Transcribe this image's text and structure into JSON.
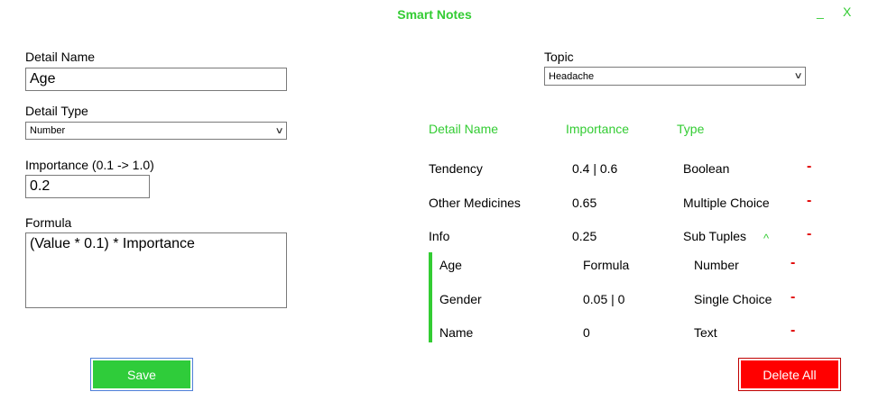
{
  "window": {
    "title": "Smart Notes",
    "minimize": "_",
    "close": "X"
  },
  "form": {
    "detail_name_label": "Detail Name",
    "detail_name_value": "Age",
    "detail_type_label": "Detail Type",
    "detail_type_value": "Number",
    "importance_label": "Importance (0.1 -> 1.0)",
    "importance_value": "0.2",
    "formula_label": "Formula",
    "formula_value": "(Value * 0.1) * Importance",
    "topic_label": "Topic",
    "topic_value": "Headache"
  },
  "table": {
    "headers": {
      "name": "Detail Name",
      "importance": "Importance",
      "type": "Type"
    },
    "rows": [
      {
        "name": "Tendency",
        "importance": "0.4 | 0.6",
        "type": "Boolean",
        "remove": "-"
      },
      {
        "name": "Other Medicines",
        "importance": "0.65",
        "type": "Multiple Choice",
        "remove": "-"
      },
      {
        "name": "Info",
        "importance": "0.25",
        "type": "Sub Tuples",
        "remove": "-",
        "expand": "^"
      }
    ],
    "subrows": [
      {
        "name": "Age",
        "importance": "Formula",
        "type": "Number",
        "remove": "-"
      },
      {
        "name": "Gender",
        "importance": "0.05 | 0",
        "type": "Single Choice",
        "remove": "-"
      },
      {
        "name": "Name",
        "importance": "0",
        "type": "Text",
        "remove": "-"
      }
    ]
  },
  "buttons": {
    "save": "Save",
    "delete_all": "Delete All"
  },
  "colors": {
    "accent": "#33cc33",
    "danger": "#ff0000",
    "save": "#2fcc3a"
  }
}
